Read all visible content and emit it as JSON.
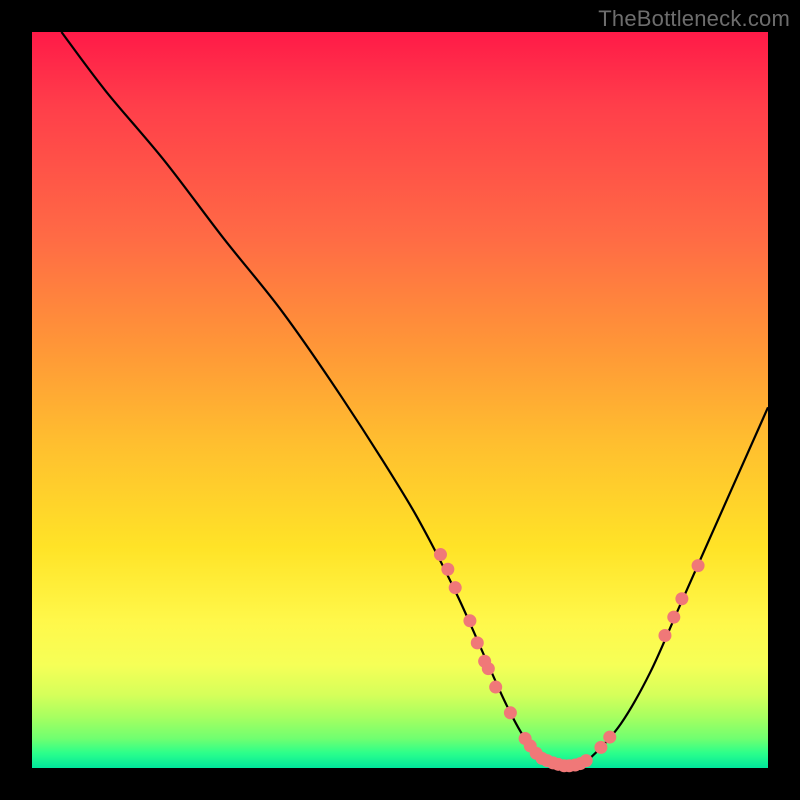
{
  "watermark": "TheBottleneck.com",
  "colors": {
    "background": "#000000",
    "curve": "#000000",
    "marker": "#f07878",
    "gradient_top": "#ff1a48",
    "gradient_bottom": "#00e69b"
  },
  "chart_data": {
    "type": "line",
    "title": "",
    "xlabel": "",
    "ylabel": "",
    "xlim": [
      0,
      100
    ],
    "ylim": [
      0,
      100
    ],
    "series": [
      {
        "name": "bottleneck-curve",
        "x": [
          4,
          10,
          18,
          26,
          34,
          42,
          50,
          54,
          58,
          62,
          64.5,
          67,
          70,
          72,
          74,
          76,
          80,
          84,
          88,
          92,
          96,
          100
        ],
        "y": [
          100,
          92,
          82.5,
          72,
          62,
          50.5,
          38,
          31,
          23,
          14,
          8.5,
          4,
          1,
          0.3,
          0.3,
          1.5,
          6,
          13,
          22,
          31,
          40,
          49
        ]
      }
    ],
    "markers": [
      {
        "x": 55.5,
        "y": 29
      },
      {
        "x": 56.5,
        "y": 27
      },
      {
        "x": 57.5,
        "y": 24.5
      },
      {
        "x": 59.5,
        "y": 20
      },
      {
        "x": 60.5,
        "y": 17
      },
      {
        "x": 61.5,
        "y": 14.5
      },
      {
        "x": 62.0,
        "y": 13.5
      },
      {
        "x": 63.0,
        "y": 11
      },
      {
        "x": 65.0,
        "y": 7.5
      },
      {
        "x": 67.0,
        "y": 4
      },
      {
        "x": 67.7,
        "y": 3
      },
      {
        "x": 68.5,
        "y": 2
      },
      {
        "x": 69.3,
        "y": 1.3
      },
      {
        "x": 70.0,
        "y": 1.0
      },
      {
        "x": 70.8,
        "y": 0.7
      },
      {
        "x": 71.5,
        "y": 0.5
      },
      {
        "x": 72.3,
        "y": 0.3
      },
      {
        "x": 73.0,
        "y": 0.3
      },
      {
        "x": 73.8,
        "y": 0.4
      },
      {
        "x": 74.5,
        "y": 0.6
      },
      {
        "x": 75.3,
        "y": 1.0
      },
      {
        "x": 77.3,
        "y": 2.8
      },
      {
        "x": 78.5,
        "y": 4.2
      },
      {
        "x": 86.0,
        "y": 18
      },
      {
        "x": 87.2,
        "y": 20.5
      },
      {
        "x": 88.3,
        "y": 23
      },
      {
        "x": 90.5,
        "y": 27.5
      }
    ]
  }
}
